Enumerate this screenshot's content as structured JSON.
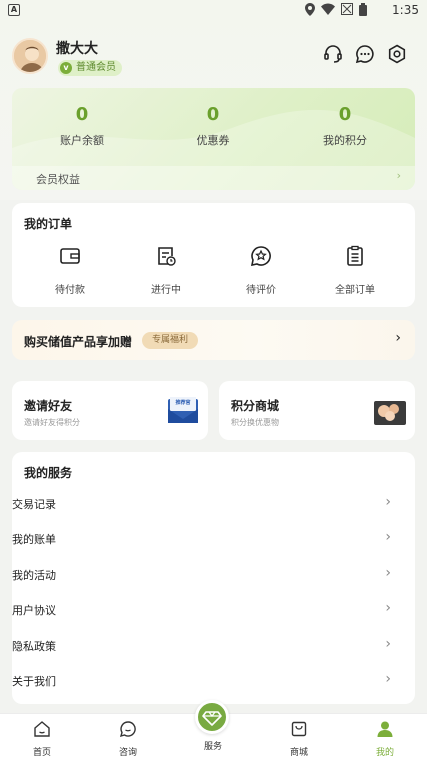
{
  "status_bar": {
    "time": "1:35",
    "android_icon": "A"
  },
  "header": {
    "username": "撒大大",
    "member_level": "普通会员",
    "member_badge_letter": "v",
    "icons": [
      "headset-icon",
      "message-icon",
      "settings-icon"
    ]
  },
  "account": {
    "balance": {
      "value": "0",
      "label": "账户余额"
    },
    "coupons": {
      "value": "0",
      "label": "优惠券"
    },
    "points": {
      "value": "0",
      "label": "我的积分"
    },
    "rights_label": "会员权益",
    "rights_chevron": "›"
  },
  "orders": {
    "title": "我的订单",
    "items": [
      {
        "label": "待付款",
        "icon": "wallet-icon"
      },
      {
        "label": "进行中",
        "icon": "order-progress-icon"
      },
      {
        "label": "待评价",
        "icon": "star-chat-icon"
      },
      {
        "label": "全部订单",
        "icon": "list-icon"
      }
    ]
  },
  "promo": {
    "title": "购买储值产品享加赠",
    "tag": "专属福利",
    "arrow": "›"
  },
  "invite": {
    "title": "邀请好友",
    "subtitle": "邀请好友得积分",
    "envelope_text": "推荐官"
  },
  "points_mall": {
    "title": "积分商城",
    "subtitle": "积分换优惠物"
  },
  "services": {
    "title": "我的服务",
    "arrow": "›",
    "items": [
      "交易记录",
      "我的账单",
      "我的活动",
      "用户协议",
      "隐私政策",
      "关于我们"
    ]
  },
  "tabbar": {
    "items": [
      {
        "label": "首页",
        "icon": "home-icon"
      },
      {
        "label": "咨询",
        "icon": "chat-icon"
      },
      {
        "label": "服务",
        "icon": "diamond-icon"
      },
      {
        "label": "商城",
        "icon": "shop-icon"
      },
      {
        "label": "我的",
        "icon": "person-icon"
      }
    ],
    "active": "我的"
  },
  "colors": {
    "accent": "#7cae3a",
    "stat_number": "#6aa02c",
    "tag_bg": "#f1dbb6"
  }
}
